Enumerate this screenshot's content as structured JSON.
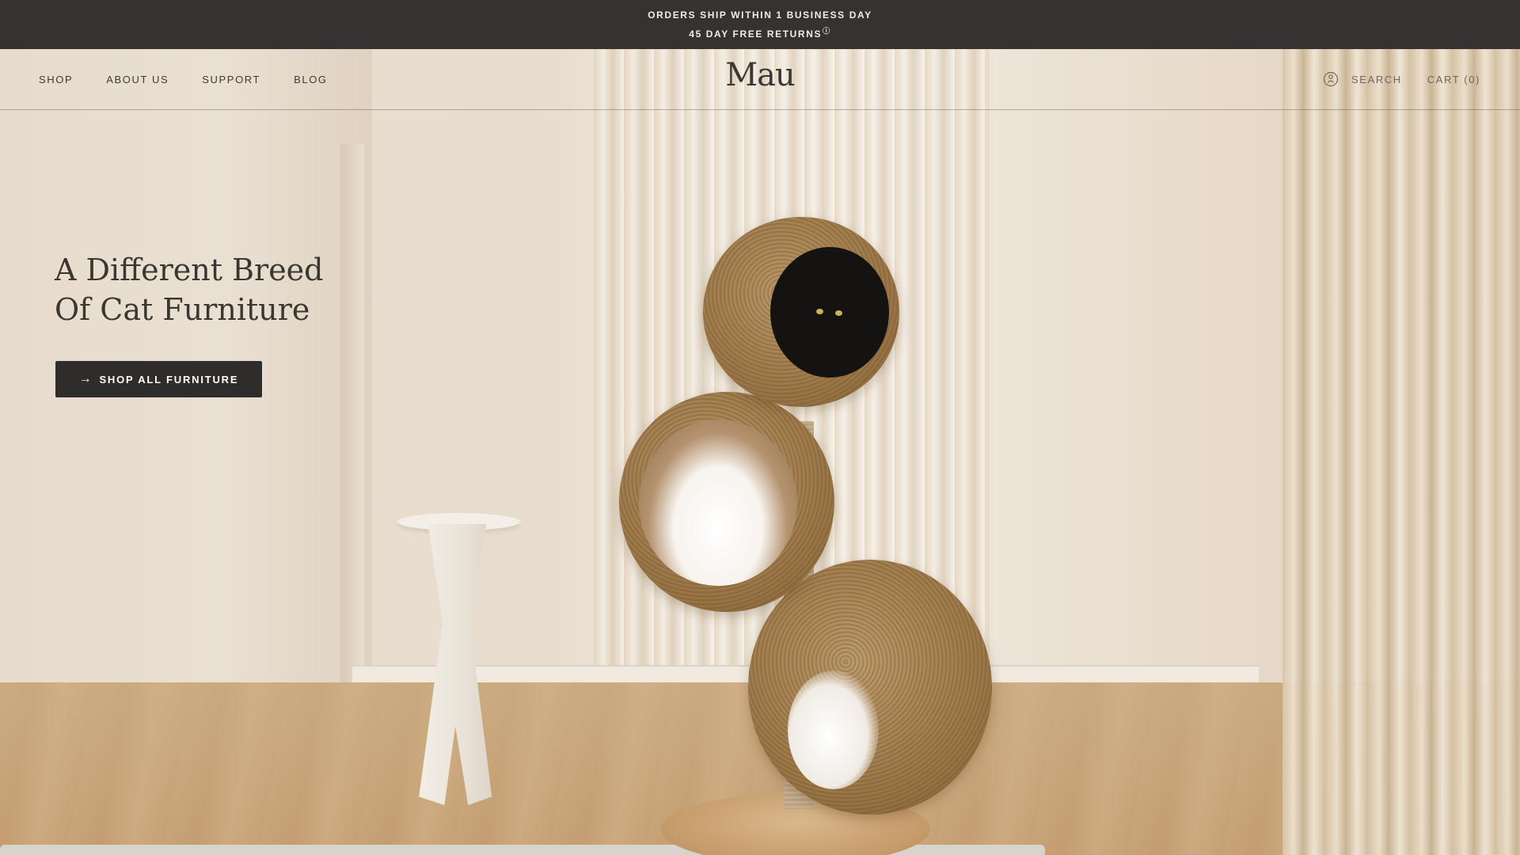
{
  "announcement": {
    "line1": "ORDERS SHIP WITHIN 1 BUSINESS DAY",
    "line2": "45 DAY FREE RETURNS",
    "line2_icon": "info-icon",
    "line2_marker": "ⓘ"
  },
  "header": {
    "nav_left": [
      {
        "label": "SHOP"
      },
      {
        "label": "ABOUT US"
      },
      {
        "label": "SUPPORT"
      },
      {
        "label": "BLOG"
      }
    ],
    "logo": "Mau",
    "account_icon": "account-icon",
    "search_label": "SEARCH",
    "cart_label": "CART (0)"
  },
  "hero": {
    "title_line1": "A Different Breed",
    "title_line2": "Of Cat Furniture",
    "cta_label": "SHOP ALL FURNITURE",
    "cta_icon": "arrow-right-icon",
    "cta_glyph": "→",
    "image_alt": "Wicker sphere cat tree with a black cat in the top sphere, beside a white side table and linen curtains"
  },
  "colors": {
    "announcement_bg": "#363232",
    "cta_bg": "#2f2d2b",
    "text_dark": "#3a3632"
  }
}
